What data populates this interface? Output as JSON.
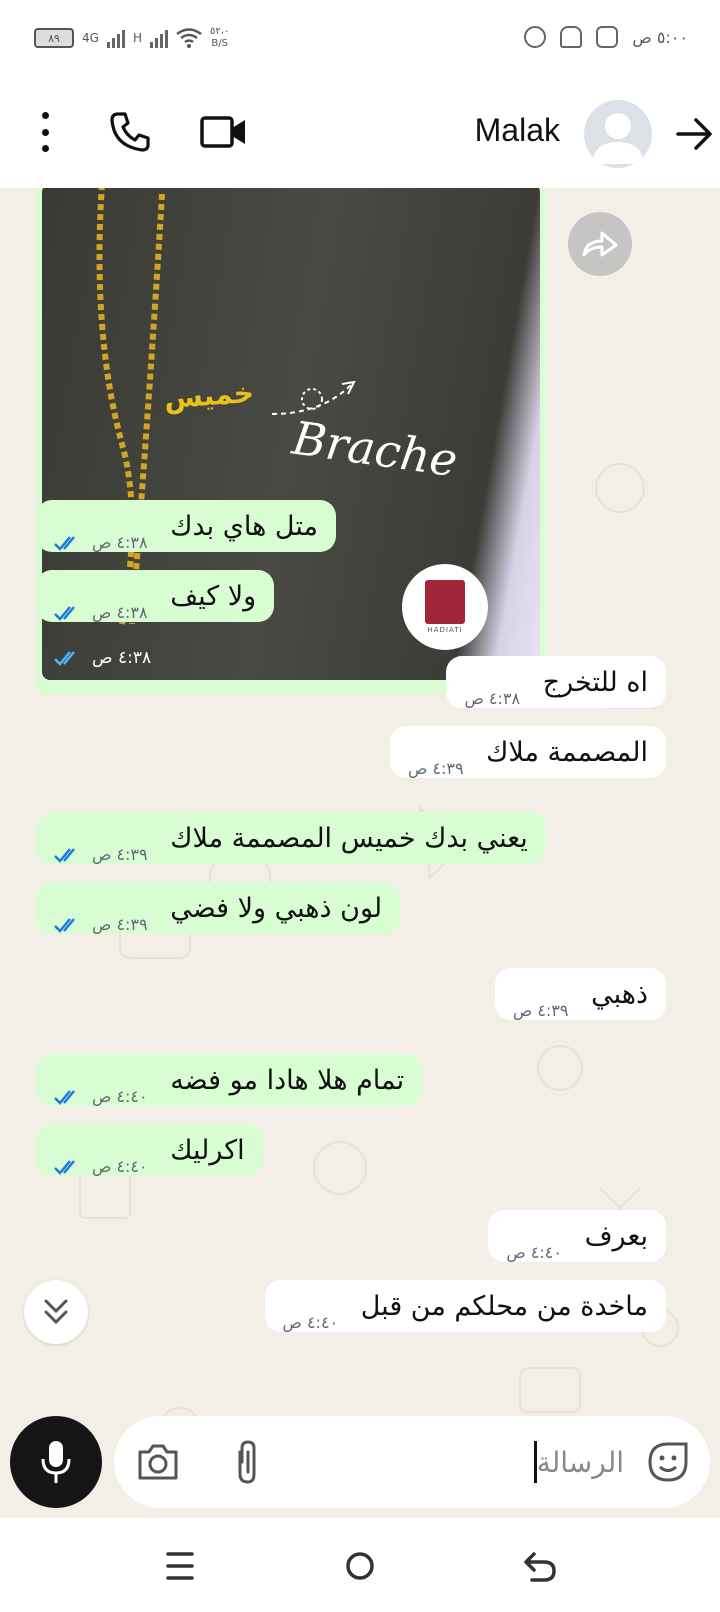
{
  "status_bar": {
    "battery": "٨٩",
    "network_1": "4G",
    "network_2": "H",
    "speed_value": "٥٢،٠",
    "speed_unit": "B/S",
    "time": "٥:٠٠ ص"
  },
  "header": {
    "contact_name": "Malak"
  },
  "image_message": {
    "overlay_text": "Brache",
    "pin_text": "خميس",
    "logo_text": "HADIATI",
    "time": "٤:٣٨ ص"
  },
  "messages": [
    {
      "dir": "out",
      "text": "متل هاي بدك",
      "time": "٤:٣٨ ص"
    },
    {
      "dir": "out",
      "text": "ولا كيف",
      "time": "٤:٣٨ ص"
    },
    {
      "dir": "in",
      "text": "اه للتخرج",
      "time": "٤:٣٨ ص"
    },
    {
      "dir": "in",
      "text": "المصممة ملاك",
      "time": "٤:٣٩ ص"
    },
    {
      "dir": "out",
      "text": "يعني بدك خميس المصممة ملاك",
      "time": "٤:٣٩ ص"
    },
    {
      "dir": "out",
      "text": "لون ذهبي ولا فضي",
      "time": "٤:٣٩ ص"
    },
    {
      "dir": "in",
      "text": "ذهبي",
      "time": "٤:٣٩ ص"
    },
    {
      "dir": "out",
      "text": "تمام هلا هادا مو فضه",
      "time": "٤:٤٠ ص"
    },
    {
      "dir": "out",
      "text": "اكرليك",
      "time": "٤:٤٠ ص"
    },
    {
      "dir": "in",
      "text": "بعرف",
      "time": "٤:٤٠ ص"
    },
    {
      "dir": "in",
      "text": "ماخدة من محلكم من قبل",
      "time": "٤:٤٠ ص"
    }
  ],
  "input": {
    "placeholder": "الرسالة"
  },
  "colors": {
    "outgoing_bubble": "#d9fdd3",
    "incoming_bubble": "#ffffff",
    "read_ticks": "#1f7ae0",
    "chat_background": "#f3eee6"
  }
}
